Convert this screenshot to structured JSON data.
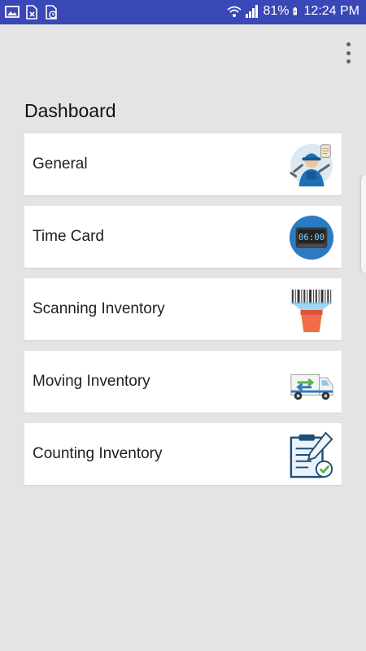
{
  "status_bar": {
    "battery": "81%",
    "time": "12:24 PM",
    "icons": [
      "image-icon",
      "file-x-icon",
      "file-clock-icon",
      "wifi-icon",
      "signal-icon",
      "battery-icon"
    ]
  },
  "app_bar": {
    "overflow_icon": "more-vert-icon"
  },
  "dashboard": {
    "title": "Dashboard",
    "items": [
      {
        "label": "General",
        "icon": "worker-icon"
      },
      {
        "label": "Time Card",
        "icon": "clock-display-icon"
      },
      {
        "label": "Scanning Inventory",
        "icon": "barcode-scanner-icon"
      },
      {
        "label": "Moving Inventory",
        "icon": "moving-truck-icon"
      },
      {
        "label": "Counting Inventory",
        "icon": "clipboard-check-icon"
      }
    ]
  },
  "colors": {
    "status_bar": "#3a47b6",
    "background": "#e4e4e4",
    "card": "#ffffff"
  }
}
